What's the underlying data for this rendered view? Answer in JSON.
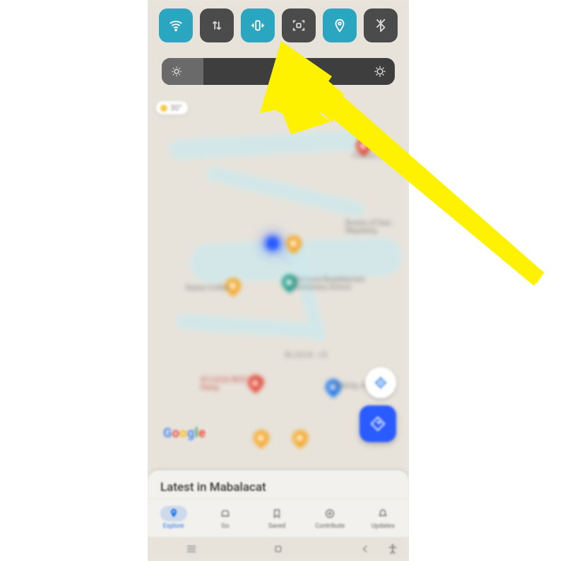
{
  "quick_settings": {
    "tiles": [
      {
        "name": "wifi",
        "active": true
      },
      {
        "name": "mobile-data",
        "active": false
      },
      {
        "name": "vibrate",
        "active": true
      },
      {
        "name": "screenshot",
        "active": false
      },
      {
        "name": "location",
        "active": true
      },
      {
        "name": "bluetooth",
        "active": false
      }
    ],
    "brightness_percent": 18
  },
  "weather": {
    "temp": "30°"
  },
  "map": {
    "block_label": "BLOCK J5",
    "labels": {
      "kantot_coffee": "Kantot Coffee",
      "sta_lucia": "Sta Lucia Resettlement Elementary School",
      "stlucia_rest": "ST.LUCIA REST mag Pamp",
      "dodong": "Dodong JunkShop",
      "bureau": "Bureau of Qua... Mapalang",
      "cheese": "Cheese wat Gra"
    }
  },
  "sheet": {
    "title": "Latest in Mabalacat"
  },
  "bottom_nav": {
    "items": [
      {
        "key": "explore",
        "label": "Explore"
      },
      {
        "key": "go",
        "label": "Go"
      },
      {
        "key": "saved",
        "label": "Saved"
      },
      {
        "key": "contribute",
        "label": "Contribute"
      },
      {
        "key": "updates",
        "label": "Updates"
      }
    ],
    "active": "explore"
  },
  "google_logo": "Google",
  "colors": {
    "accent": "#2aa6c0",
    "qs_dark": "#4b4b4b",
    "blue": "#1a73e8"
  }
}
